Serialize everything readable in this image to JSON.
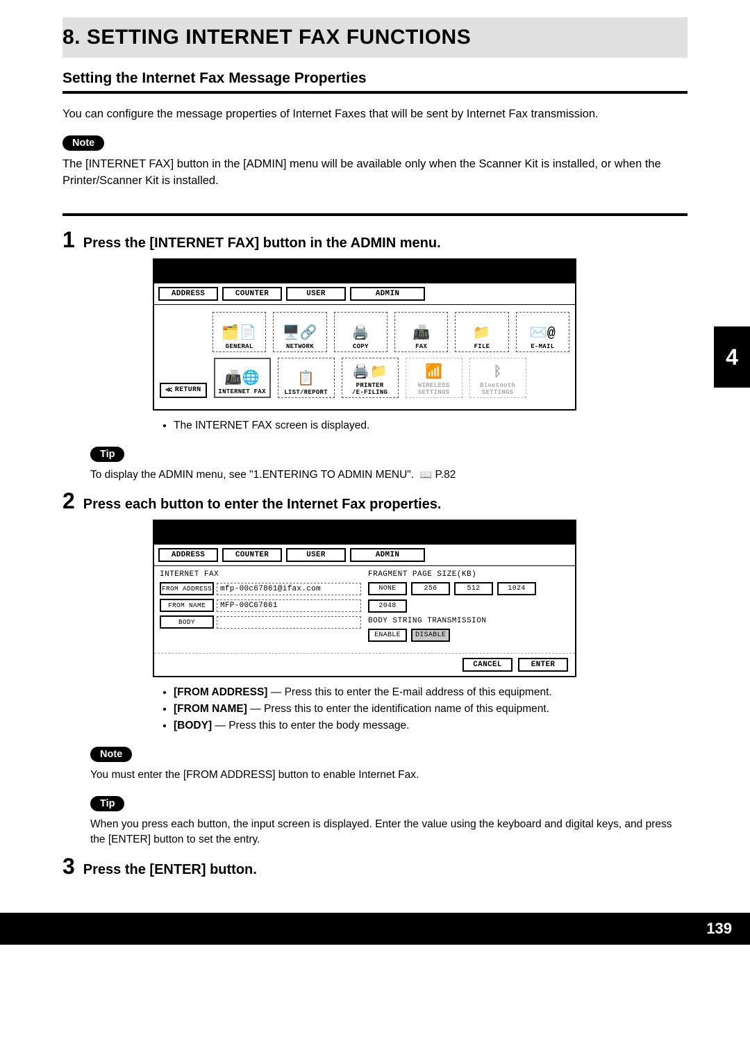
{
  "chapter": "8. SETTING INTERNET FAX FUNCTIONS",
  "section_title": "Setting the Internet Fax Message Properties",
  "intro": "You can configure the message properties of Internet Faxes that will be sent by Internet Fax transmission.",
  "note_label": "Note",
  "tip_label": "Tip",
  "note1": "The [INTERNET FAX] button in the [ADMIN] menu will be available only when the Scanner Kit is installed, or when the Printer/Scanner Kit is installed.",
  "steps": {
    "s1": {
      "num": "1",
      "text": "Press the [INTERNET FAX] button in the ADMIN menu."
    },
    "s2": {
      "num": "2",
      "text": "Press each button to enter the Internet Fax properties."
    },
    "s3": {
      "num": "3",
      "text": "Press the [ENTER] button."
    }
  },
  "mock1": {
    "tabs": {
      "address": "ADDRESS",
      "counter": "COUNTER",
      "user": "USER",
      "admin": "ADMIN"
    },
    "icons_row1": {
      "general": "GENERAL",
      "network": "NETWORK",
      "copy": "COPY",
      "fax": "FAX",
      "file": "FILE",
      "email": "E-MAIL"
    },
    "icons_row2": {
      "ifax": "INTERNET FAX",
      "list": "LIST/REPORT",
      "printer": "PRINTER\n/E-FILING",
      "wireless": "WIRELESS\nSETTINGS",
      "bt": "Bluetooth\nSETTINGS"
    },
    "return": "RETURN"
  },
  "after_mock1_bullet": "The INTERNET FAX screen is displayed.",
  "tip1": "To display the ADMIN menu, see \"1.ENTERING TO ADMIN MENU\".",
  "tip1_ref": "P.82",
  "mock2": {
    "header_left": "INTERNET FAX",
    "from_address_label": "FROM ADDRESS",
    "from_address_value": "mfp-00c67861@ifax.com",
    "from_name_label": "FROM NAME",
    "from_name_value": "MFP-00C67861",
    "body_label": "BODY",
    "body_value": "",
    "frag_title": "FRAGMENT PAGE SIZE(KB)",
    "frag_options": {
      "none": "NONE",
      "o256": "256",
      "o512": "512",
      "o1024": "1024",
      "o2048": "2048"
    },
    "bodytx_title": "BODY STRING TRANSMISSION",
    "bodytx": {
      "enable": "ENABLE",
      "disable": "DISABLE"
    },
    "cancel": "CANCEL",
    "enter": "ENTER"
  },
  "defs": {
    "from_address": {
      "label": "[FROM ADDRESS]",
      "desc": " — Press this to enter the E-mail address of this equipment."
    },
    "from_name": {
      "label": "[FROM NAME]",
      "desc": " — Press this to enter the identification name of this equipment."
    },
    "body": {
      "label": "[BODY]",
      "desc": " — Press this to enter the body message."
    }
  },
  "note2": "You must enter the [FROM ADDRESS] button to enable Internet Fax.",
  "tip2": "When you press each button, the input screen is displayed.  Enter the value using the keyboard and digital keys, and press the [ENTER] button to set the entry.",
  "side_tab": "4",
  "page_number": "139"
}
